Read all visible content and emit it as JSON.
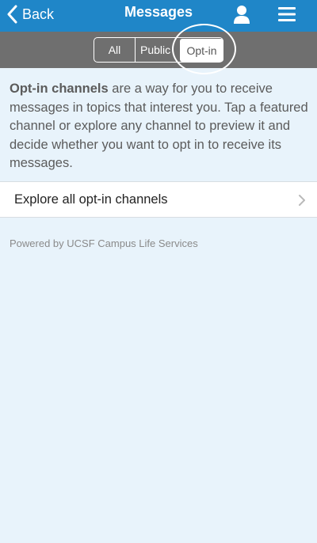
{
  "nav": {
    "back_label": "Back",
    "title": "Messages",
    "profile_icon": "person-icon",
    "menu_icon": "hamburger-menu-icon"
  },
  "segments": {
    "all": "All",
    "public": "Public",
    "optin": "Opt-in",
    "selected": "Opt-in"
  },
  "intro": {
    "bold": "Opt-in channels",
    "text": " are a way for you to receive messages in topics that interest you. Tap a featured channel or explore any channel to preview it and decide whether you want to opt in to receive its messages."
  },
  "explore": {
    "label": "Explore all opt-in channels",
    "icon": "chevron-right-icon"
  },
  "footer": {
    "text": "Powered by UCSF Campus Life Services"
  },
  "colors": {
    "navbar": "#1f86c8",
    "segment_bar": "#6f6f6f",
    "background": "#e8f3fb"
  }
}
